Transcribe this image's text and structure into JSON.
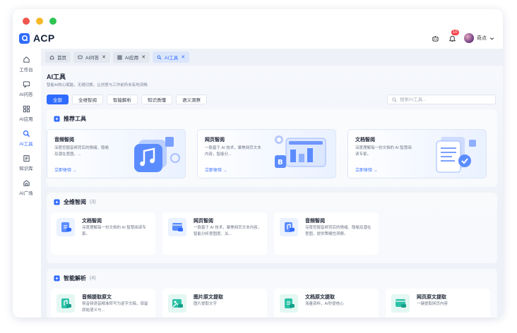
{
  "app": {
    "name": "ACP"
  },
  "topbar": {
    "notification_count": "10",
    "user_name": "奇点"
  },
  "sidebar": {
    "items": [
      {
        "label": "工作台",
        "icon": "home-icon"
      },
      {
        "label": "AI问答",
        "icon": "chat-icon"
      },
      {
        "label": "AI应用",
        "icon": "apps-icon"
      },
      {
        "label": "AI工具",
        "icon": "tools-icon",
        "active": true
      },
      {
        "label": "知识库",
        "icon": "book-icon"
      },
      {
        "label": "AI广场",
        "icon": "plaza-icon"
      }
    ]
  },
  "tabs": [
    {
      "label": "首页",
      "icon": "home-icon",
      "closable": false
    },
    {
      "label": "AI问答",
      "icon": "chat-icon",
      "closable": true
    },
    {
      "label": "AI应用",
      "icon": "apps-icon",
      "closable": true
    },
    {
      "label": "AI工具",
      "icon": "tools-icon",
      "closable": true,
      "active": true
    }
  ],
  "page": {
    "title": "AI工具",
    "subtitle": "智能AI核心赋能，无缝切换，让创意与工作前所未有地流畅"
  },
  "filters": [
    "全部",
    "全维智阅",
    "智能解析",
    "知识质懂",
    "语义洞察"
  ],
  "search": {
    "placeholder": "搜索AI工具..."
  },
  "recommended": {
    "title": "推荐工具",
    "cards": [
      {
        "title": "音频智阅",
        "desc": "深度挖掘音频背后的情绪、隐喻及潜在意图。...",
        "link": "立即体验 →"
      },
      {
        "title": "网页智阅",
        "desc": "一款基于 AI 技术，聚焦网页文本内容，智能分...",
        "link": "立即体验 →"
      },
      {
        "title": "文档智阅",
        "desc": "深度理解每一份文档的 AI 智慧阅读专家。",
        "link": "立即体验 →"
      }
    ]
  },
  "full_read": {
    "title": "全维智阅",
    "count": "(3)",
    "tools": [
      {
        "title": "文档智阅",
        "desc": "深度理解每一份文档的 AI 智慧阅读专家。"
      },
      {
        "title": "网页智阅",
        "desc": "一款基于 AI 技术，聚焦网页文本内容，智能分析意图度、关..."
      },
      {
        "title": "音频智阅",
        "desc": "深度挖掘音频背后的情绪、隐喻及潜在意图，提供策略性洞察。"
      }
    ]
  },
  "smart_parse": {
    "title": "智能解析",
    "count": "(4)",
    "tools": [
      {
        "title": "音频提取原文",
        "desc": "将音频语音精准转写为逐字文稿，保留原始语义与..."
      },
      {
        "title": "图片原文提取",
        "desc": "图片提取文字"
      },
      {
        "title": "文档原文提取",
        "desc": "海量资料，AI秒提核心"
      },
      {
        "title": "网页原文提取",
        "desc": "一键提取网页内容"
      }
    ]
  },
  "colors": {
    "accent": "#2f6bff",
    "badge": "#f5424a"
  }
}
